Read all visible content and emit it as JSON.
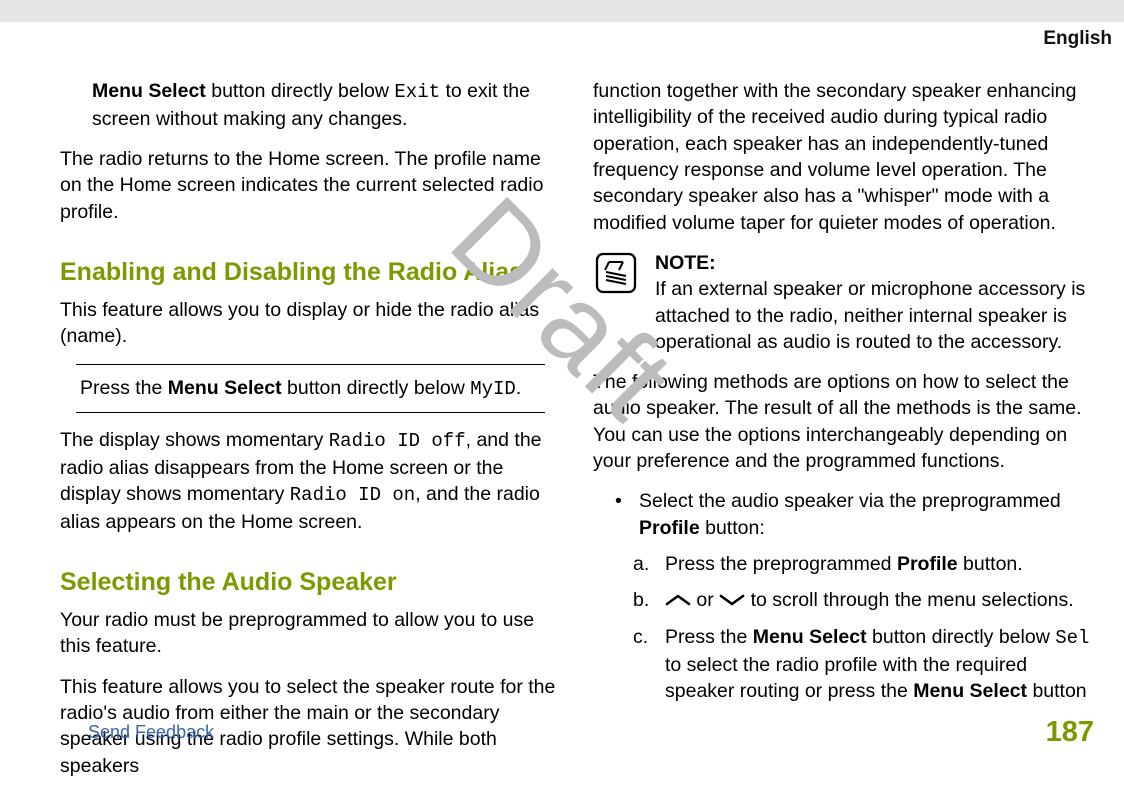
{
  "header": {
    "language": "English"
  },
  "watermark": "Draft",
  "left": {
    "p1": {
      "b1": "Menu Select",
      "t1": " button directly below ",
      "c1": "Exit",
      "t2": " to exit the screen without making any changes."
    },
    "p2": "The radio returns to the Home screen. The profile name on the Home screen indicates the current selected radio profile.",
    "h1": "Enabling and Disabling the Radio Alias",
    "p3": "This feature allows you to display or hide the radio alias (name).",
    "p4": {
      "t1": "Press the ",
      "b1": "Menu Select",
      "t2": " button directly below ",
      "c1": "MyID",
      "t3": "."
    },
    "p5": {
      "t1": "The display shows momentary ",
      "c1": "Radio ID off",
      "t2": ", and the radio alias disappears from the Home screen or the display shows momentary ",
      "c2": "Radio ID on",
      "t3": ", and the radio alias appears on the Home screen."
    },
    "h2": "Selecting the Audio Speaker",
    "p6": "Your radio must be preprogrammed to allow you to use this feature.",
    "p7": "This feature allows you to select the speaker route for the radio's audio from either the main or the secondary speaker using the radio profile settings. While both speakers"
  },
  "right": {
    "p1": "function together with the secondary speaker enhancing intelligibility of the received audio during typical radio operation, each speaker has an independently-tuned frequency response and volume level operation. The secondary speaker also has a \"whisper\" mode with a modified volume taper for quieter modes of operation.",
    "note": {
      "title": "NOTE:",
      "body": "If an external speaker or microphone accessory is attached to the radio, neither internal speaker is operational as audio is routed to the accessory."
    },
    "p2": "The following methods are options on how to select the audio speaker. The result of all the methods is the same. You can use the options interchangeably depending on your preference and the programmed functions.",
    "bullet": {
      "t1": "Select the audio speaker via the preprogrammed ",
      "b1": "Profile",
      "t2": " button:"
    },
    "a": {
      "lbl": "a.",
      "t1": "Press the preprogrammed ",
      "b1": "Profile",
      "t2": " button."
    },
    "b": {
      "lbl": "b.",
      "t1": " or ",
      "t2": " to scroll through the menu selections."
    },
    "c": {
      "lbl": "c.",
      "t1": "Press the ",
      "b1": "Menu Select",
      "t2": " button directly below ",
      "c1": "Sel",
      "t3": " to select the radio profile with the required speaker routing or press the ",
      "b2": "Menu Select",
      "t4": " button"
    }
  },
  "footer": {
    "feedback": "Send Feedback",
    "page": "187"
  }
}
